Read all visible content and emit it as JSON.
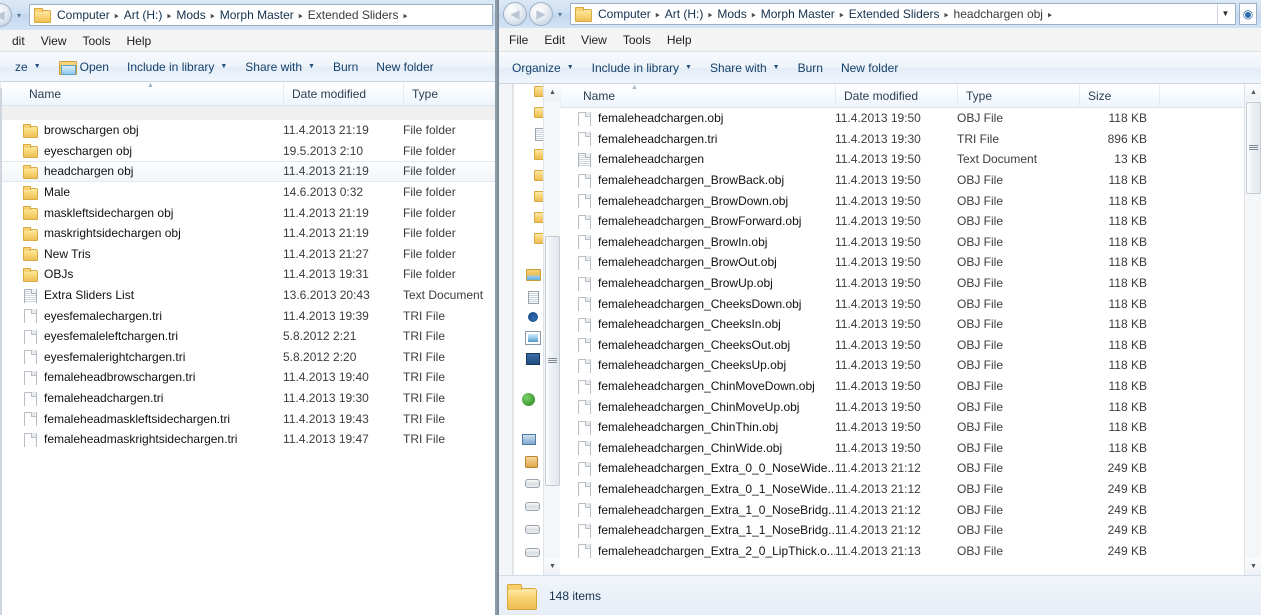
{
  "left_window": {
    "name": "explorer-window-left",
    "address": {
      "crumbs": [
        "Computer",
        "Art (H:)",
        "Mods",
        "Morph Master",
        "Extended Sliders"
      ],
      "separator": "▸"
    },
    "menu": [
      "dit",
      "View",
      "Tools",
      "Help"
    ],
    "toolbar": [
      {
        "label": "ze",
        "caret": true,
        "icon": "none"
      },
      {
        "label": "Open",
        "caret": false,
        "icon": "open-folder-icon"
      },
      {
        "label": "Include in library",
        "caret": true,
        "icon": "none"
      },
      {
        "label": "Share with",
        "caret": true,
        "icon": "none"
      },
      {
        "label": "Burn",
        "caret": false,
        "icon": "none"
      },
      {
        "label": "New folder",
        "caret": false,
        "icon": "none"
      }
    ],
    "columns": [
      "Name",
      "Date modified",
      "Type"
    ],
    "rows": [
      {
        "name": "browschargen obj",
        "date": "11.4.2013 21:19",
        "type": "File folder",
        "icon": "folder",
        "selected": false
      },
      {
        "name": "eyeschargen obj",
        "date": "19.5.2013 2:10",
        "type": "File folder",
        "icon": "folder",
        "selected": false
      },
      {
        "name": "headchargen obj",
        "date": "11.4.2013 21:19",
        "type": "File folder",
        "icon": "folder",
        "selected": true
      },
      {
        "name": "Male",
        "date": "14.6.2013 0:32",
        "type": "File folder",
        "icon": "folder",
        "selected": false
      },
      {
        "name": "maskleftsidechargen obj",
        "date": "11.4.2013 21:19",
        "type": "File folder",
        "icon": "folder",
        "selected": false
      },
      {
        "name": "maskrightsidechargen obj",
        "date": "11.4.2013 21:19",
        "type": "File folder",
        "icon": "folder",
        "selected": false
      },
      {
        "name": "New Tris",
        "date": "11.4.2013 21:27",
        "type": "File folder",
        "icon": "folder",
        "selected": false
      },
      {
        "name": "OBJs",
        "date": "11.4.2013 19:31",
        "type": "File folder",
        "icon": "folder",
        "selected": false
      },
      {
        "name": "Extra Sliders List",
        "date": "13.6.2013 20:43",
        "type": "Text Document",
        "icon": "text",
        "selected": false
      },
      {
        "name": "eyesfemalechargen.tri",
        "date": "11.4.2013 19:39",
        "type": "TRI File",
        "icon": "file",
        "selected": false
      },
      {
        "name": "eyesfemaleleftchargen.tri",
        "date": "5.8.2012 2:21",
        "type": "TRI File",
        "icon": "file",
        "selected": false
      },
      {
        "name": "eyesfemalerightchargen.tri",
        "date": "5.8.2012 2:20",
        "type": "TRI File",
        "icon": "file",
        "selected": false
      },
      {
        "name": "femaleheadbrowschargen.tri",
        "date": "11.4.2013 19:40",
        "type": "TRI File",
        "icon": "file",
        "selected": false
      },
      {
        "name": "femaleheadchargen.tri",
        "date": "11.4.2013 19:30",
        "type": "TRI File",
        "icon": "file",
        "selected": false
      },
      {
        "name": "femaleheadmaskleftsidechargen.tri",
        "date": "11.4.2013 19:43",
        "type": "TRI File",
        "icon": "file",
        "selected": false
      },
      {
        "name": "femaleheadmaskrightsidechargen.tri",
        "date": "11.4.2013 19:47",
        "type": "TRI File",
        "icon": "file",
        "selected": false
      }
    ]
  },
  "right_window": {
    "name": "explorer-window-right",
    "address": {
      "crumbs": [
        "Computer",
        "Art (H:)",
        "Mods",
        "Morph Master",
        "Extended Sliders",
        "headchargen obj"
      ],
      "separator": "▸",
      "caret": "▼"
    },
    "nav": {
      "back_glyph": "◀",
      "forward_glyph": "▶",
      "history_glyph": "▾"
    },
    "search_glyph": "⌕",
    "menu": [
      "File",
      "Edit",
      "View",
      "Tools",
      "Help"
    ],
    "toolbar": [
      {
        "label": "Organize",
        "caret": true
      },
      {
        "label": "Include in library",
        "caret": true
      },
      {
        "label": "Share with",
        "caret": true
      },
      {
        "label": "Burn",
        "caret": false
      },
      {
        "label": "New folder",
        "caret": false
      }
    ],
    "columns": [
      "Name",
      "Date modified",
      "Type",
      "Size"
    ],
    "rows": [
      {
        "name": "femaleheadchargen.obj",
        "date": "11.4.2013 19:50",
        "type": "OBJ File",
        "size": "118 KB",
        "icon": "file"
      },
      {
        "name": "femaleheadchargen.tri",
        "date": "11.4.2013 19:30",
        "type": "TRI File",
        "size": "896 KB",
        "icon": "file"
      },
      {
        "name": "femaleheadchargen",
        "date": "11.4.2013 19:50",
        "type": "Text Document",
        "size": "13 KB",
        "icon": "text"
      },
      {
        "name": "femaleheadchargen_BrowBack.obj",
        "date": "11.4.2013 19:50",
        "type": "OBJ File",
        "size": "118 KB",
        "icon": "file"
      },
      {
        "name": "femaleheadchargen_BrowDown.obj",
        "date": "11.4.2013 19:50",
        "type": "OBJ File",
        "size": "118 KB",
        "icon": "file"
      },
      {
        "name": "femaleheadchargen_BrowForward.obj",
        "date": "11.4.2013 19:50",
        "type": "OBJ File",
        "size": "118 KB",
        "icon": "file"
      },
      {
        "name": "femaleheadchargen_BrowIn.obj",
        "date": "11.4.2013 19:50",
        "type": "OBJ File",
        "size": "118 KB",
        "icon": "file"
      },
      {
        "name": "femaleheadchargen_BrowOut.obj",
        "date": "11.4.2013 19:50",
        "type": "OBJ File",
        "size": "118 KB",
        "icon": "file"
      },
      {
        "name": "femaleheadchargen_BrowUp.obj",
        "date": "11.4.2013 19:50",
        "type": "OBJ File",
        "size": "118 KB",
        "icon": "file"
      },
      {
        "name": "femaleheadchargen_CheeksDown.obj",
        "date": "11.4.2013 19:50",
        "type": "OBJ File",
        "size": "118 KB",
        "icon": "file"
      },
      {
        "name": "femaleheadchargen_CheeksIn.obj",
        "date": "11.4.2013 19:50",
        "type": "OBJ File",
        "size": "118 KB",
        "icon": "file"
      },
      {
        "name": "femaleheadchargen_CheeksOut.obj",
        "date": "11.4.2013 19:50",
        "type": "OBJ File",
        "size": "118 KB",
        "icon": "file"
      },
      {
        "name": "femaleheadchargen_CheeksUp.obj",
        "date": "11.4.2013 19:50",
        "type": "OBJ File",
        "size": "118 KB",
        "icon": "file"
      },
      {
        "name": "femaleheadchargen_ChinMoveDown.obj",
        "date": "11.4.2013 19:50",
        "type": "OBJ File",
        "size": "118 KB",
        "icon": "file"
      },
      {
        "name": "femaleheadchargen_ChinMoveUp.obj",
        "date": "11.4.2013 19:50",
        "type": "OBJ File",
        "size": "118 KB",
        "icon": "file"
      },
      {
        "name": "femaleheadchargen_ChinThin.obj",
        "date": "11.4.2013 19:50",
        "type": "OBJ File",
        "size": "118 KB",
        "icon": "file"
      },
      {
        "name": "femaleheadchargen_ChinWide.obj",
        "date": "11.4.2013 19:50",
        "type": "OBJ File",
        "size": "118 KB",
        "icon": "file"
      },
      {
        "name": "femaleheadchargen_Extra_0_0_NoseWide...",
        "date": "11.4.2013 21:12",
        "type": "OBJ File",
        "size": "249 KB",
        "icon": "file"
      },
      {
        "name": "femaleheadchargen_Extra_0_1_NoseWide...",
        "date": "11.4.2013 21:12",
        "type": "OBJ File",
        "size": "249 KB",
        "icon": "file"
      },
      {
        "name": "femaleheadchargen_Extra_1_0_NoseBridg...",
        "date": "11.4.2013 21:12",
        "type": "OBJ File",
        "size": "249 KB",
        "icon": "file"
      },
      {
        "name": "femaleheadchargen_Extra_1_1_NoseBridg...",
        "date": "11.4.2013 21:12",
        "type": "OBJ File",
        "size": "249 KB",
        "icon": "file"
      },
      {
        "name": "femaleheadchargen_Extra_2_0_LipThick.o...",
        "date": "11.4.2013 21:13",
        "type": "OBJ File",
        "size": "249 KB",
        "icon": "file"
      }
    ],
    "status": {
      "item_count": "148 items"
    },
    "scroll": {
      "up_glyph": "▲",
      "down_glyph": "▼"
    }
  },
  "nav_pane": {
    "name": "navigation-pane-collapsed",
    "icons": [
      "folder-icon",
      "folder-icon",
      "document-icon",
      "folder-icon",
      "folder-icon",
      "folder-icon",
      "folder-icon",
      "folder-icon",
      "libraries-icon",
      "documents-library-icon",
      "music-library-icon",
      "pictures-library-icon",
      "videos-library-icon",
      "homegroup-icon",
      "computer-icon",
      "user-folder-icon",
      "drive-icon",
      "drive-icon",
      "drive-icon",
      "drive-icon"
    ]
  },
  "colors": {
    "desktop": "#24425c",
    "window_chrome": "#f0f0f0",
    "accent_blue": "#14406b",
    "selection": "#f2f6fa",
    "folder_yellow": "#f8d271"
  }
}
